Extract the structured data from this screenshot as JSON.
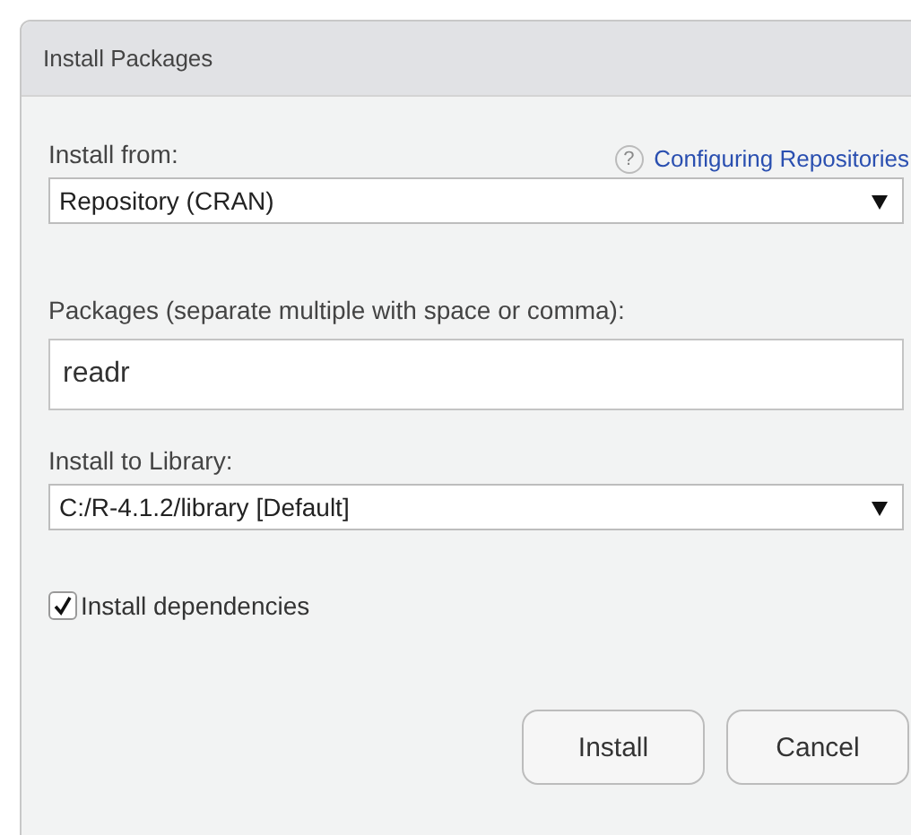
{
  "window": {
    "title": "Install Packages"
  },
  "install_from": {
    "label": "Install from:",
    "help_icon": "?",
    "help_link": "Configuring Repositories",
    "value": "Repository (CRAN)"
  },
  "packages": {
    "label": "Packages (separate multiple with space or comma):",
    "value": "readr"
  },
  "library": {
    "label": "Install to Library:",
    "value": "C:/R-4.1.2/library [Default]"
  },
  "dependencies": {
    "label": "Install dependencies",
    "checked": true
  },
  "buttons": [
    "Install",
    "Cancel"
  ]
}
